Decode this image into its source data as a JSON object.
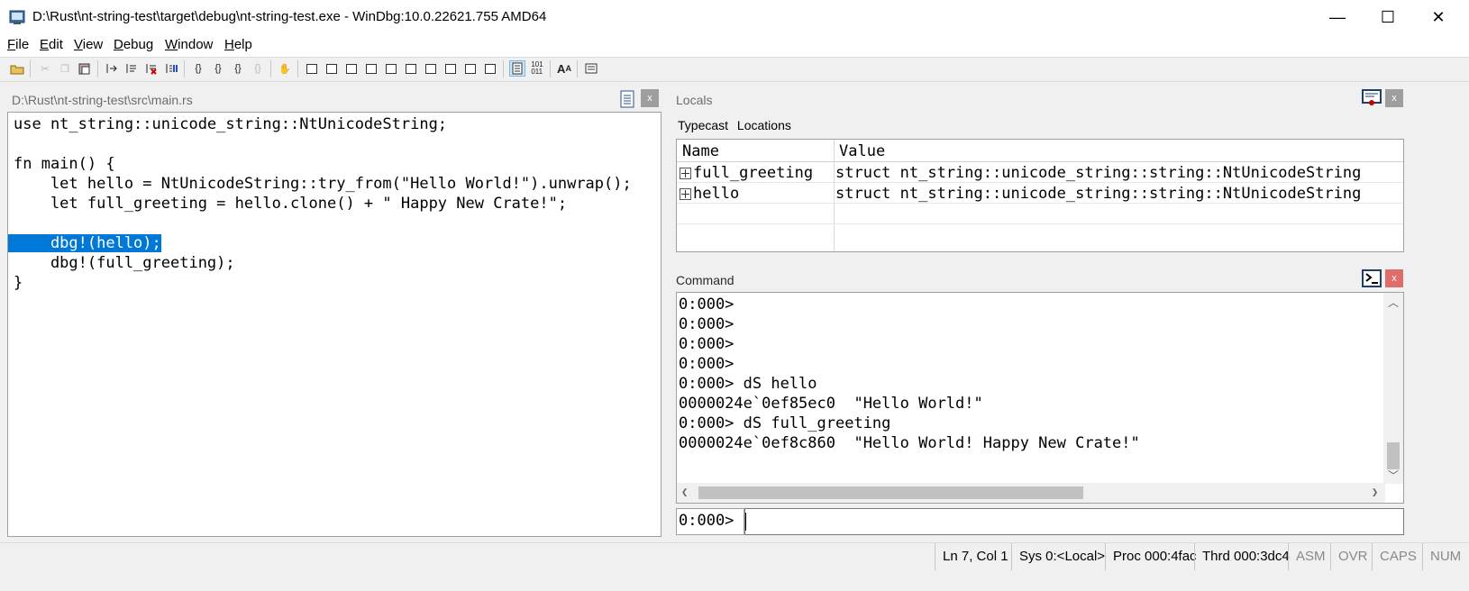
{
  "window": {
    "title": "D:\\Rust\\nt-string-test\\target\\debug\\nt-string-test.exe - WinDbg:10.0.22621.755 AMD64",
    "minimize": "—",
    "maximize": "☐",
    "close": "✕"
  },
  "menu": [
    "File",
    "Edit",
    "View",
    "Debug",
    "Window",
    "Help"
  ],
  "source": {
    "title": "D:\\Rust\\nt-string-test\\src\\main.rs",
    "close": "x",
    "lines": [
      "use nt_string::unicode_string::NtUnicodeString;",
      "",
      "fn main() {",
      "    let hello = NtUnicodeString::try_from(\"Hello World!\").unwrap();",
      "    let full_greeting = hello.clone() + \" Happy New Crate!\";",
      "",
      "    dbg!(hello);",
      "    dbg!(full_greeting);",
      "}"
    ],
    "current_line_index": 6
  },
  "locals": {
    "title": "Locals",
    "close": "x",
    "tabs": [
      "Typecast",
      "Locations"
    ],
    "columns": [
      "Name",
      "Value"
    ],
    "rows": [
      {
        "name": "full_greeting",
        "value": "struct nt_string::unicode_string::string::NtUnicodeString"
      },
      {
        "name": "hello",
        "value": "struct nt_string::unicode_string::string::NtUnicodeString"
      }
    ]
  },
  "command": {
    "title": "Command",
    "close": "x",
    "output": [
      "0:000>",
      "0:000>",
      "0:000>",
      "0:000>",
      "0:000> dS hello",
      "0000024e`0ef85ec0  \"Hello World!\"",
      "0:000> dS full_greeting",
      "0000024e`0ef8c860  \"Hello World! Happy New Crate!\""
    ],
    "prompt": "0:000>",
    "input_value": ""
  },
  "status": {
    "position": "Ln 7, Col 1",
    "sys": "Sys 0:<Local>",
    "proc": "Proc 000:4fac",
    "thrd": "Thrd 000:3dc4",
    "asm": "ASM",
    "ovr": "OVR",
    "caps": "CAPS",
    "num": "NUM"
  },
  "colors": {
    "selection": "#0078d7",
    "panel_header_text": "#6d6d6d",
    "command_close": "#e06c6c"
  },
  "toolbar_icons": [
    "open-icon",
    "cut-icon",
    "copy-icon",
    "paste-icon",
    "go-icon",
    "restart-icon",
    "stop-icon",
    "break-icon",
    "step-into-icon",
    "step-over-icon",
    "step-out-icon",
    "run-to-cursor-icon",
    "hand-icon",
    "command-window-icon",
    "watch-icon",
    "locals-icon",
    "registers-icon",
    "memory-icon",
    "call-stack-icon",
    "disassembly-icon",
    "scratch-pad-icon",
    "processes-icon",
    "source-mode-icon",
    "hex-icon",
    "font-icon",
    "options-icon"
  ]
}
